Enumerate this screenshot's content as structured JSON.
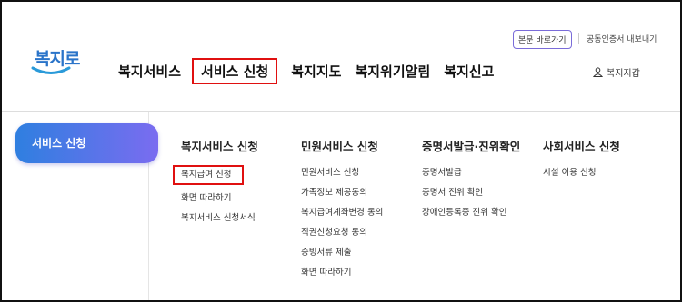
{
  "header": {
    "logo_text": "복지로",
    "nav": [
      "복지서비스",
      "서비스 신청",
      "복지지도",
      "복지위기알림",
      "복지신고"
    ],
    "utility": {
      "skip_button": "본문 바로가기",
      "cert_export": "공동인증서 내보내기"
    },
    "wallet_label": "복지지갑"
  },
  "menu": {
    "active_tab": "서비스 신청",
    "columns": [
      {
        "title": "복지서비스 신청",
        "items": [
          "복지급여 신청",
          "화면 따라하기",
          "복지서비스 신청서식"
        ]
      },
      {
        "title": "민원서비스 신청",
        "items": [
          "민원서비스 신청",
          "가족정보 제공동의",
          "복지급여계좌변경 동의",
          "직권신청요청 동의",
          "증빙서류 제출",
          "화면 따라하기"
        ]
      },
      {
        "title": "증명서발급·진위확인",
        "items": [
          "증명서발급",
          "증명서 진위 확인",
          "장애인등록증 진위 확인"
        ]
      },
      {
        "title": "사회서비스 신청",
        "items": [
          "시설 이용 신청"
        ]
      }
    ]
  },
  "colors": {
    "highlight": "#e01010",
    "tab_gradient_start": "#2f7fe0",
    "tab_gradient_end": "#7a6cf0",
    "logo": "#2a74c9"
  }
}
